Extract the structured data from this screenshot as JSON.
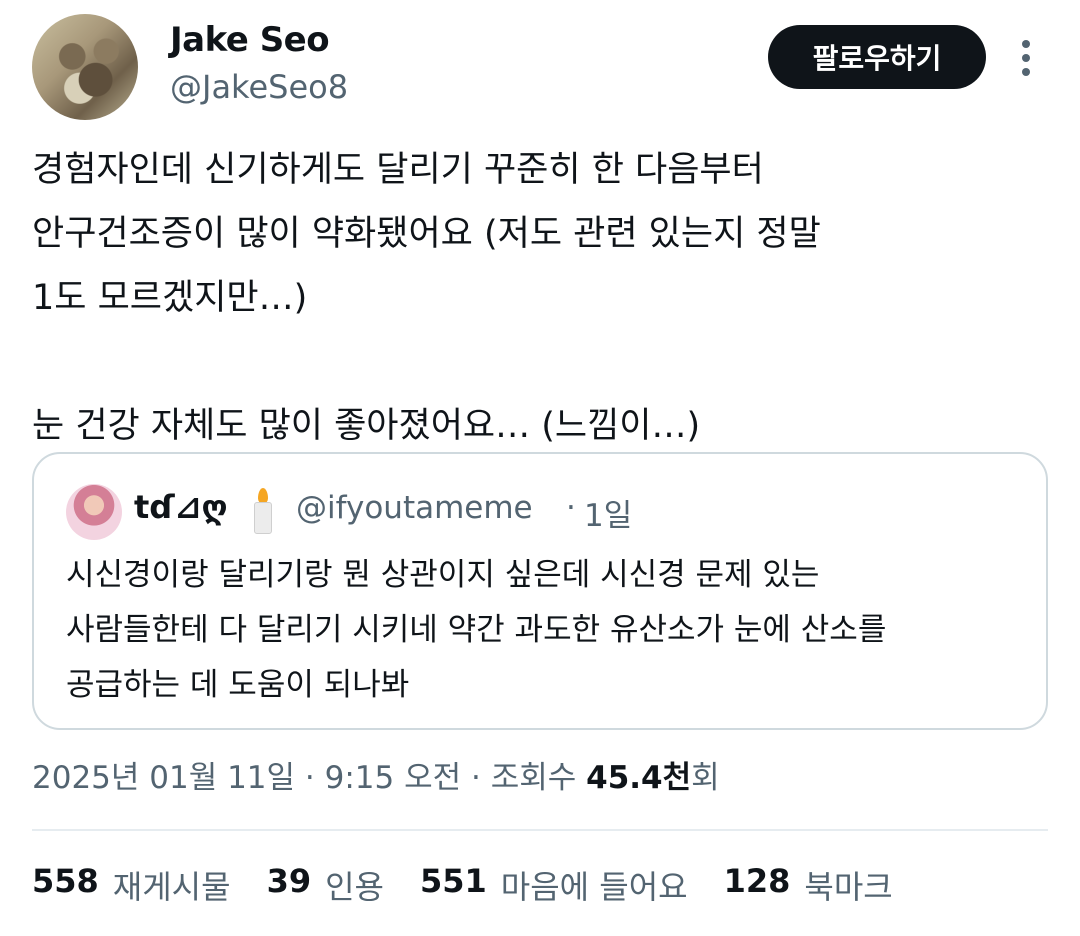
{
  "author": {
    "name": "Jake Seo",
    "handle": "@JakeSeo8",
    "follow_label": "팔로우하기"
  },
  "tweet": {
    "text": "경험자인데 신기하게도 달리기 꾸준히 한 다음부터\n안구건조증이 많이 약화됐어요 (저도 관련 있는지 정말\n1도 모르겠지만…)\n\n눈 건강 자체도 많이 좋아졌어요… (느낌이…)"
  },
  "quote": {
    "name": "tɗ⊿ღ",
    "emoji": "candle",
    "handle": "@ifyoutameme",
    "separator": "·",
    "time": "1일",
    "text": "시신경이랑 달리기랑 뭔 상관이지 싶은데 시신경 문제 있는\n사람들한테 다 달리기 시키네 약간 과도한 유산소가 눈에 산소를\n공급하는 데 도움이 되나봐"
  },
  "meta": {
    "date": "2025년 01월 11일",
    "sep1": " · ",
    "time": "9:15 오전",
    "sep2": " · ",
    "views_label": "조회수 ",
    "views_count": "45.4천",
    "views_suffix": "회"
  },
  "stats": [
    {
      "count": "558",
      "label": "재게시물"
    },
    {
      "count": "39",
      "label": "인용"
    },
    {
      "count": "551",
      "label": "마음에 들어요"
    },
    {
      "count": "128",
      "label": "북마크"
    }
  ],
  "colors": {
    "text": "#0f1419",
    "secondary": "#536471",
    "border": "#cfd9de",
    "button_bg": "#0f1419"
  }
}
